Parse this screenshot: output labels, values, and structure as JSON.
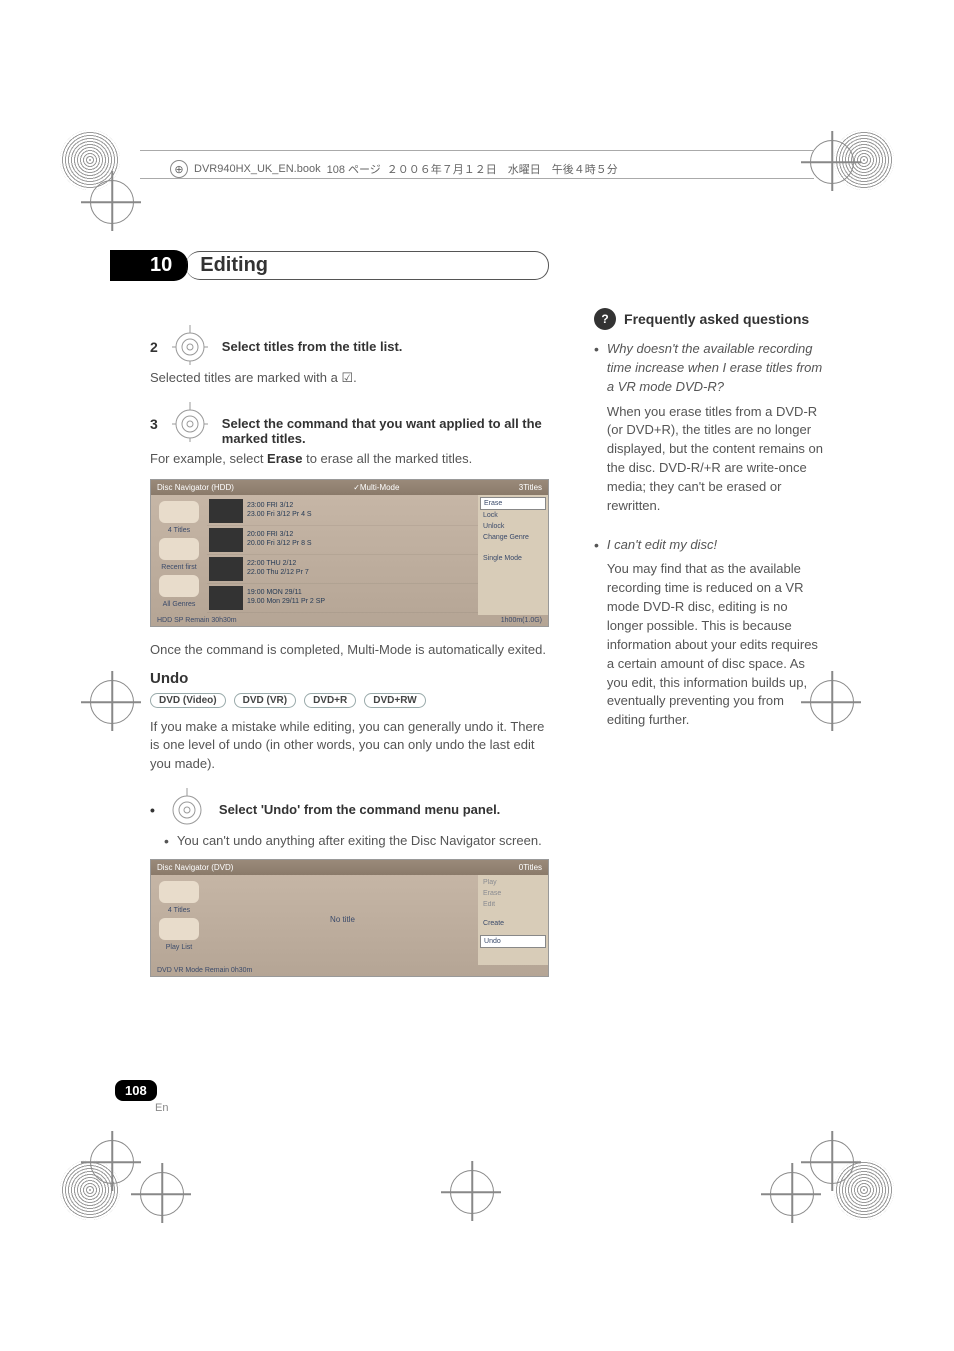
{
  "header": {
    "filename": "DVR940HX_UK_EN.book",
    "page_jp": "108 ページ",
    "date_jp": "２００６年７月１２日　水曜日　午後４時５分"
  },
  "chapter": {
    "number": "10",
    "title": "Editing"
  },
  "left": {
    "step2": {
      "num": "2",
      "text": "Select titles from the title list."
    },
    "step2_sub": "Selected titles are marked with a ",
    "step2_sub_mark": "☑",
    "step2_sub_end": ".",
    "step3": {
      "num": "3",
      "text": "Select the command that you want applied to all the marked titles."
    },
    "step3_sub_a": "For example, select ",
    "step3_sub_b": "Erase",
    "step3_sub_c": " to erase all the marked titles.",
    "ss1": {
      "title": "Disc Navigator (HDD)",
      "mode": "✓Multi-Mode",
      "count": "3Titles",
      "side": {
        "a": "4 Titles",
        "b": "Recent first",
        "c": "All Genres"
      },
      "rows": [
        {
          "t1": "23:00 FRI 3/12",
          "t2": "23.00   Fri  3/12  Pr 4  S"
        },
        {
          "t1": "20:00 FRI 3/12",
          "t2": "20.00   Fri  3/12  Pr 8  S"
        },
        {
          "t1": "22:00 THU 2/12",
          "t2": "22.00   Thu  2/12  Pr 7"
        },
        {
          "t1": "19:00 MON 29/11",
          "t2": "19.00   Mon  29/11  Pr 2  SP"
        }
      ],
      "menu": {
        "erase": "Erase",
        "lock": "Lock",
        "unlock": "Unlock",
        "change": "Change Genre",
        "single": "Single Mode"
      },
      "foot_l": "HDD SP",
      "foot_l2": "Remain 30h30m",
      "foot_r": "1h00m(1.0G)"
    },
    "after_ss1": "Once the command is completed, Multi-Mode is automatically exited.",
    "undo_title": "Undo",
    "badges": {
      "a": "DVD (Video)",
      "b": "DVD (VR)",
      "c": "DVD+R",
      "d": "DVD+RW"
    },
    "undo_body": "If you make a mistake while editing, you can generally undo it. There is one level of undo (in other words, you can only undo the last edit you made).",
    "undo_step": "Select 'Undo' from the command menu panel.",
    "undo_bullet": "You can't undo anything after exiting the Disc Navigator screen.",
    "ss2": {
      "title": "Disc Navigator (DVD)",
      "count": "0Titles",
      "side": {
        "a": "4 Titles",
        "b": "Play List"
      },
      "center": "No title",
      "menu": {
        "play": "Play",
        "erase": "Erase",
        "edit": "Edit",
        "create": "Create",
        "undo": "Undo"
      },
      "foot_l": "DVD VR Mode",
      "foot_l2": "Remain 0h30m"
    }
  },
  "right": {
    "faq_title": "Frequently asked questions",
    "q1": "Why doesn't the available recording time increase when I erase titles from a VR mode DVD-R?",
    "a1": "When you erase titles from a DVD-R (or DVD+R), the titles are no longer displayed, but the content remains on the disc. DVD-R/+R are write-once media; they can't be erased or rewritten.",
    "q2": "I can't edit my disc!",
    "a2": "You may find that as the available recording time is reduced on a VR mode DVD-R disc, editing is no longer possible. This is because information about your edits requires a certain amount of disc space. As you edit, this information builds up, eventually preventing you from editing further."
  },
  "page": {
    "num": "108",
    "lang": "En"
  }
}
